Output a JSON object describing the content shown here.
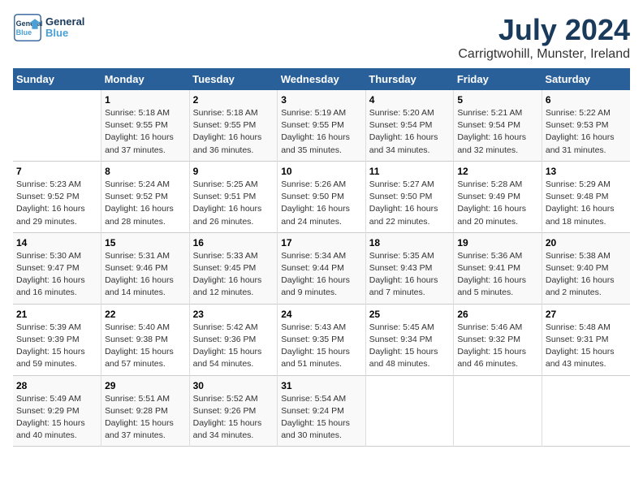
{
  "header": {
    "logo_line1": "General",
    "logo_line2": "Blue",
    "month": "July 2024",
    "location": "Carrigtwohill, Munster, Ireland"
  },
  "days_of_week": [
    "Sunday",
    "Monday",
    "Tuesday",
    "Wednesday",
    "Thursday",
    "Friday",
    "Saturday"
  ],
  "weeks": [
    [
      {
        "day": "",
        "info": ""
      },
      {
        "day": "1",
        "info": "Sunrise: 5:18 AM\nSunset: 9:55 PM\nDaylight: 16 hours\nand 37 minutes."
      },
      {
        "day": "2",
        "info": "Sunrise: 5:18 AM\nSunset: 9:55 PM\nDaylight: 16 hours\nand 36 minutes."
      },
      {
        "day": "3",
        "info": "Sunrise: 5:19 AM\nSunset: 9:55 PM\nDaylight: 16 hours\nand 35 minutes."
      },
      {
        "day": "4",
        "info": "Sunrise: 5:20 AM\nSunset: 9:54 PM\nDaylight: 16 hours\nand 34 minutes."
      },
      {
        "day": "5",
        "info": "Sunrise: 5:21 AM\nSunset: 9:54 PM\nDaylight: 16 hours\nand 32 minutes."
      },
      {
        "day": "6",
        "info": "Sunrise: 5:22 AM\nSunset: 9:53 PM\nDaylight: 16 hours\nand 31 minutes."
      }
    ],
    [
      {
        "day": "7",
        "info": "Sunrise: 5:23 AM\nSunset: 9:52 PM\nDaylight: 16 hours\nand 29 minutes."
      },
      {
        "day": "8",
        "info": "Sunrise: 5:24 AM\nSunset: 9:52 PM\nDaylight: 16 hours\nand 28 minutes."
      },
      {
        "day": "9",
        "info": "Sunrise: 5:25 AM\nSunset: 9:51 PM\nDaylight: 16 hours\nand 26 minutes."
      },
      {
        "day": "10",
        "info": "Sunrise: 5:26 AM\nSunset: 9:50 PM\nDaylight: 16 hours\nand 24 minutes."
      },
      {
        "day": "11",
        "info": "Sunrise: 5:27 AM\nSunset: 9:50 PM\nDaylight: 16 hours\nand 22 minutes."
      },
      {
        "day": "12",
        "info": "Sunrise: 5:28 AM\nSunset: 9:49 PM\nDaylight: 16 hours\nand 20 minutes."
      },
      {
        "day": "13",
        "info": "Sunrise: 5:29 AM\nSunset: 9:48 PM\nDaylight: 16 hours\nand 18 minutes."
      }
    ],
    [
      {
        "day": "14",
        "info": "Sunrise: 5:30 AM\nSunset: 9:47 PM\nDaylight: 16 hours\nand 16 minutes."
      },
      {
        "day": "15",
        "info": "Sunrise: 5:31 AM\nSunset: 9:46 PM\nDaylight: 16 hours\nand 14 minutes."
      },
      {
        "day": "16",
        "info": "Sunrise: 5:33 AM\nSunset: 9:45 PM\nDaylight: 16 hours\nand 12 minutes."
      },
      {
        "day": "17",
        "info": "Sunrise: 5:34 AM\nSunset: 9:44 PM\nDaylight: 16 hours\nand 9 minutes."
      },
      {
        "day": "18",
        "info": "Sunrise: 5:35 AM\nSunset: 9:43 PM\nDaylight: 16 hours\nand 7 minutes."
      },
      {
        "day": "19",
        "info": "Sunrise: 5:36 AM\nSunset: 9:41 PM\nDaylight: 16 hours\nand 5 minutes."
      },
      {
        "day": "20",
        "info": "Sunrise: 5:38 AM\nSunset: 9:40 PM\nDaylight: 16 hours\nand 2 minutes."
      }
    ],
    [
      {
        "day": "21",
        "info": "Sunrise: 5:39 AM\nSunset: 9:39 PM\nDaylight: 15 hours\nand 59 minutes."
      },
      {
        "day": "22",
        "info": "Sunrise: 5:40 AM\nSunset: 9:38 PM\nDaylight: 15 hours\nand 57 minutes."
      },
      {
        "day": "23",
        "info": "Sunrise: 5:42 AM\nSunset: 9:36 PM\nDaylight: 15 hours\nand 54 minutes."
      },
      {
        "day": "24",
        "info": "Sunrise: 5:43 AM\nSunset: 9:35 PM\nDaylight: 15 hours\nand 51 minutes."
      },
      {
        "day": "25",
        "info": "Sunrise: 5:45 AM\nSunset: 9:34 PM\nDaylight: 15 hours\nand 48 minutes."
      },
      {
        "day": "26",
        "info": "Sunrise: 5:46 AM\nSunset: 9:32 PM\nDaylight: 15 hours\nand 46 minutes."
      },
      {
        "day": "27",
        "info": "Sunrise: 5:48 AM\nSunset: 9:31 PM\nDaylight: 15 hours\nand 43 minutes."
      }
    ],
    [
      {
        "day": "28",
        "info": "Sunrise: 5:49 AM\nSunset: 9:29 PM\nDaylight: 15 hours\nand 40 minutes."
      },
      {
        "day": "29",
        "info": "Sunrise: 5:51 AM\nSunset: 9:28 PM\nDaylight: 15 hours\nand 37 minutes."
      },
      {
        "day": "30",
        "info": "Sunrise: 5:52 AM\nSunset: 9:26 PM\nDaylight: 15 hours\nand 34 minutes."
      },
      {
        "day": "31",
        "info": "Sunrise: 5:54 AM\nSunset: 9:24 PM\nDaylight: 15 hours\nand 30 minutes."
      },
      {
        "day": "",
        "info": ""
      },
      {
        "day": "",
        "info": ""
      },
      {
        "day": "",
        "info": ""
      }
    ]
  ]
}
